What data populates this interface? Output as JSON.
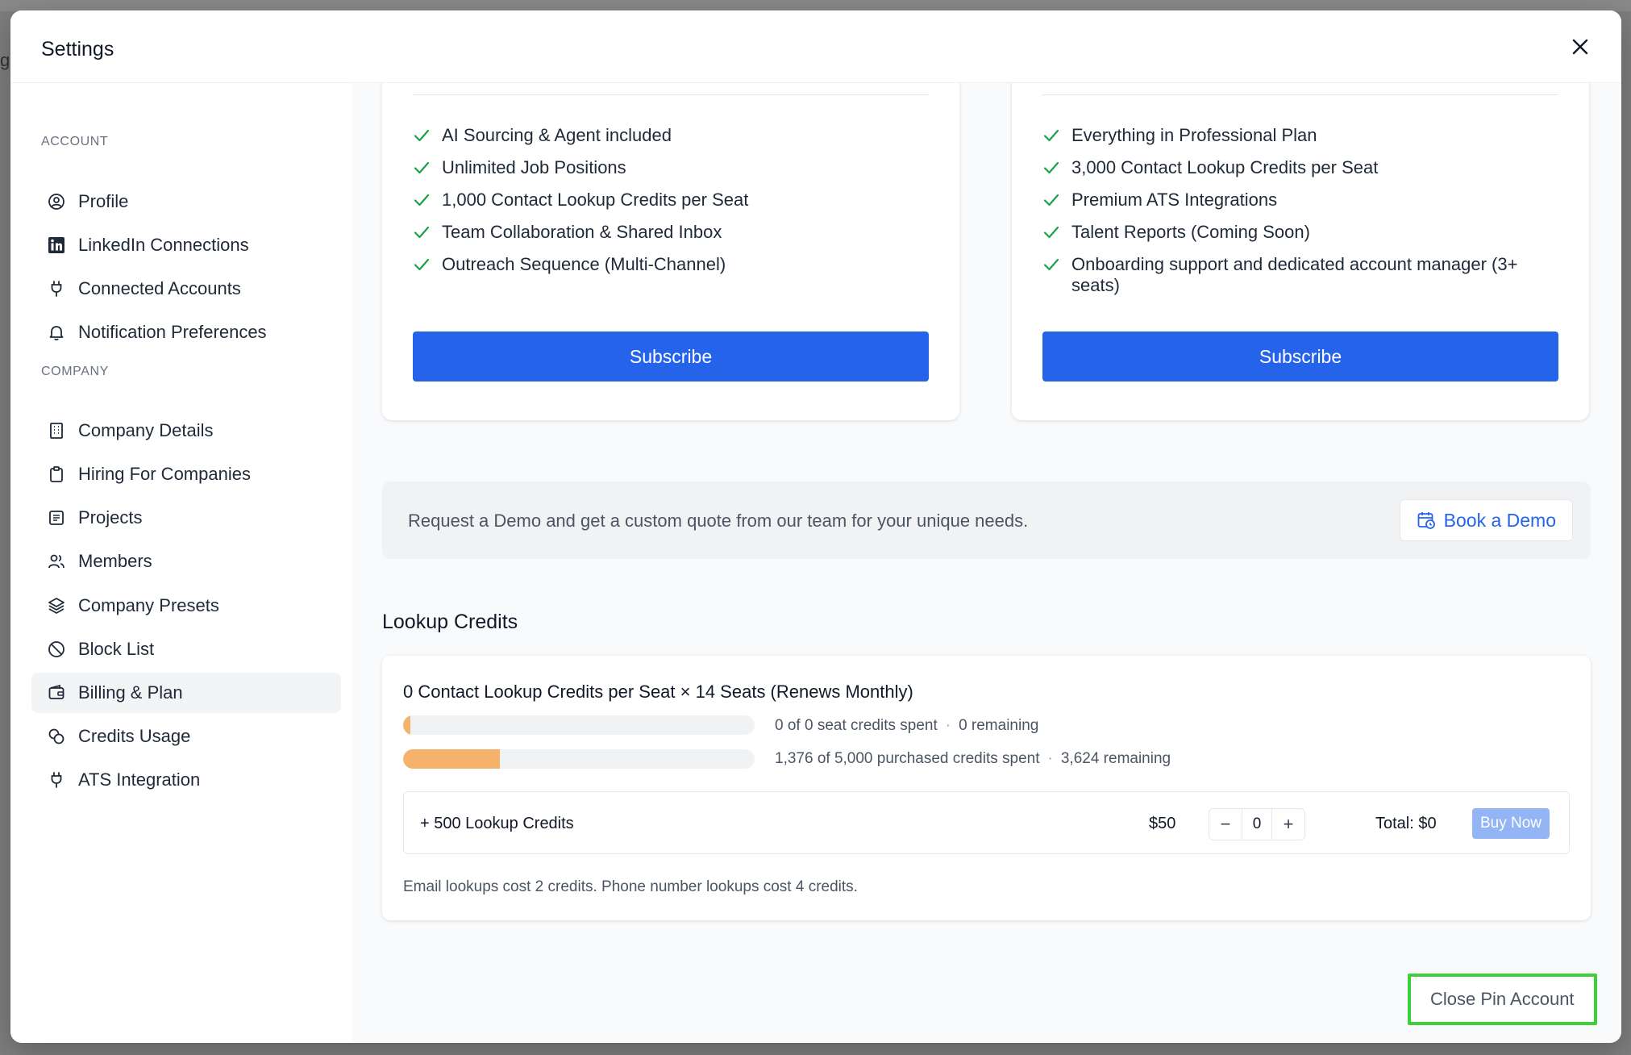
{
  "modal": {
    "title": "Settings"
  },
  "sidebar": {
    "account_label": "ACCOUNT",
    "company_label": "COMPANY",
    "account_items": [
      {
        "label": "Profile",
        "icon": "user-circle-icon"
      },
      {
        "label": "LinkedIn Connections",
        "icon": "linkedin-icon"
      },
      {
        "label": "Connected Accounts",
        "icon": "plug-icon"
      },
      {
        "label": "Notification Preferences",
        "icon": "bell-icon"
      }
    ],
    "company_items": [
      {
        "label": "Company Details",
        "icon": "building-icon"
      },
      {
        "label": "Hiring For Companies",
        "icon": "clipboard-icon"
      },
      {
        "label": "Projects",
        "icon": "list-doc-icon"
      },
      {
        "label": "Members",
        "icon": "users-icon"
      },
      {
        "label": "Company Presets",
        "icon": "layers-icon"
      },
      {
        "label": "Block List",
        "icon": "block-icon"
      },
      {
        "label": "Billing & Plan",
        "icon": "wallet-icon",
        "active": true
      },
      {
        "label": "Credits Usage",
        "icon": "coins-icon"
      },
      {
        "label": "ATS Integration",
        "icon": "plug-icon"
      }
    ]
  },
  "plans": [
    {
      "features": [
        "AI Sourcing & Agent included",
        "Unlimited Job Positions",
        "1,000 Contact Lookup Credits per Seat",
        "Team Collaboration & Shared Inbox",
        "Outreach Sequence (Multi-Channel)"
      ],
      "button": "Subscribe"
    },
    {
      "features": [
        "Everything in Professional Plan",
        "3,000 Contact Lookup Credits per Seat",
        "Premium ATS Integrations",
        "Talent Reports (Coming Soon)",
        "Onboarding support and dedicated account manager (3+ seats)"
      ],
      "button": "Subscribe"
    }
  ],
  "demo": {
    "text": "Request a Demo and get a custom quote from our team for your unique needs.",
    "button": "Book a Demo"
  },
  "lookup": {
    "title": "Lookup Credits",
    "heading": "0 Contact Lookup Credits per Seat × 14 Seats (Renews Monthly)",
    "seat_spent": "0 of 0 seat credits spent",
    "seat_remaining": "0 remaining",
    "seat_fraction": 0,
    "purchased_spent": "1,376 of 5,000 purchased credits spent",
    "purchased_remaining": "3,624 remaining",
    "purchased_fraction": 0.2752,
    "buy_label": "+ 500 Lookup Credits",
    "buy_price": "$50",
    "minus": "−",
    "quantity": "0",
    "plus": "+",
    "total": "Total: $0",
    "buy_now": "Buy Now",
    "footnote": "Email lookups cost 2 credits. Phone number lookups cost 4 credits."
  },
  "danger": {
    "close_account": "Close Pin Account"
  },
  "colors": {
    "primary": "#2563eb",
    "bar_fill": "#f5b26b",
    "check": "#16a34a",
    "highlight": "#3ecf3a"
  }
}
